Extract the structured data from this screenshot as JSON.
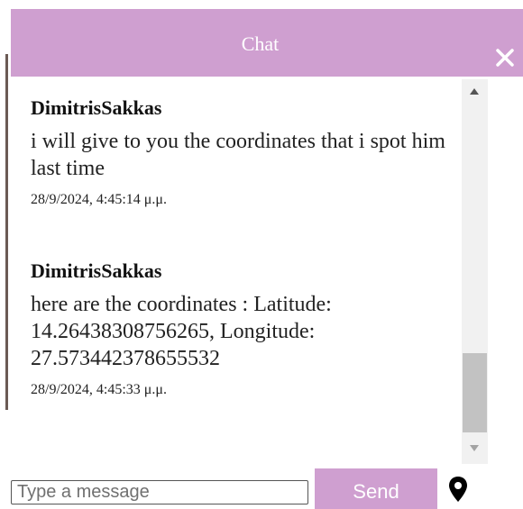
{
  "chat": {
    "title": "Chat",
    "messages": [
      {
        "sender": "DimitrisSakkas",
        "text": "i will give to you the coordinates that i spot him last time",
        "timestamp": "28/9/2024, 4:45:14 μ.μ."
      },
      {
        "sender": "DimitrisSakkas",
        "text": "here are the coordinates : Latitude: 14.26438308756265, Longitude: 27.573442378655532",
        "timestamp": "28/9/2024, 4:45:33 μ.μ."
      }
    ]
  },
  "composer": {
    "placeholder": "Type a message",
    "send_label": "Send"
  },
  "icons": {
    "close": "close-icon",
    "location": "location-pin-icon"
  },
  "colors": {
    "header": "#cf9fd0",
    "send_button": "#cf9fd0"
  }
}
